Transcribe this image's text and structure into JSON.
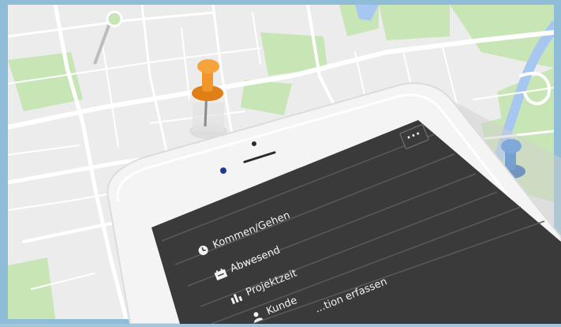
{
  "menu": {
    "more_label": "···",
    "items": [
      {
        "label": "Kommen/Gehen",
        "icon": "clock-icon"
      },
      {
        "label": "Abwesend",
        "icon": "absence-icon"
      },
      {
        "label": "Projektzeit",
        "icon": "project-icon"
      },
      {
        "label": "Kunde",
        "icon": "customer-icon"
      },
      {
        "label": "...tion erfassen",
        "icon": "entry-icon"
      }
    ]
  },
  "pins": [
    {
      "name": "orange-pin",
      "color": "#f0962a"
    },
    {
      "name": "blue-pin",
      "color": "#1f6fd1"
    }
  ],
  "colors": {
    "map_background": "#ececec",
    "road": "#ffffff",
    "park": "#c8e6b5",
    "water": "#a6c8f0",
    "screen": "#3a3a3a",
    "phone_body": "#f4f4f4"
  }
}
